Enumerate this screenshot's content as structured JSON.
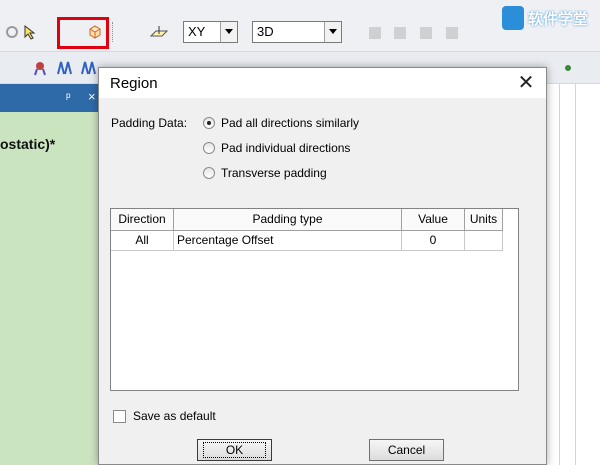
{
  "toolbar": {
    "axis_combo": {
      "value": "XY"
    },
    "view_combo": {
      "value": "3D"
    }
  },
  "watermark": {
    "logo_text": "软件学堂"
  },
  "background": {
    "model_label": "ostatic)*",
    "pane_header_icons": "ᵖ ×"
  },
  "dialog": {
    "title": "Region",
    "close_label": "✕",
    "padding_data_label": "Padding Data:",
    "radio_options": [
      {
        "label": "Pad all directions similarly",
        "selected": true
      },
      {
        "label": "Pad individual directions",
        "selected": false
      },
      {
        "label": "Transverse padding",
        "selected": false
      }
    ],
    "table": {
      "columns": [
        "Direction",
        "Padding type",
        "Value",
        "Units"
      ],
      "rows": [
        {
          "direction": "All",
          "padding_type": "Percentage Offset",
          "value": "0",
          "units": ""
        }
      ]
    },
    "save_default_label": "Save as default",
    "save_default_checked": false,
    "ok_label": "OK",
    "cancel_label": "Cancel"
  },
  "colors": {
    "highlight_border": "#e00010",
    "pane_header": "#2f6aa8",
    "left_pane_green": "#cbe4c0"
  }
}
